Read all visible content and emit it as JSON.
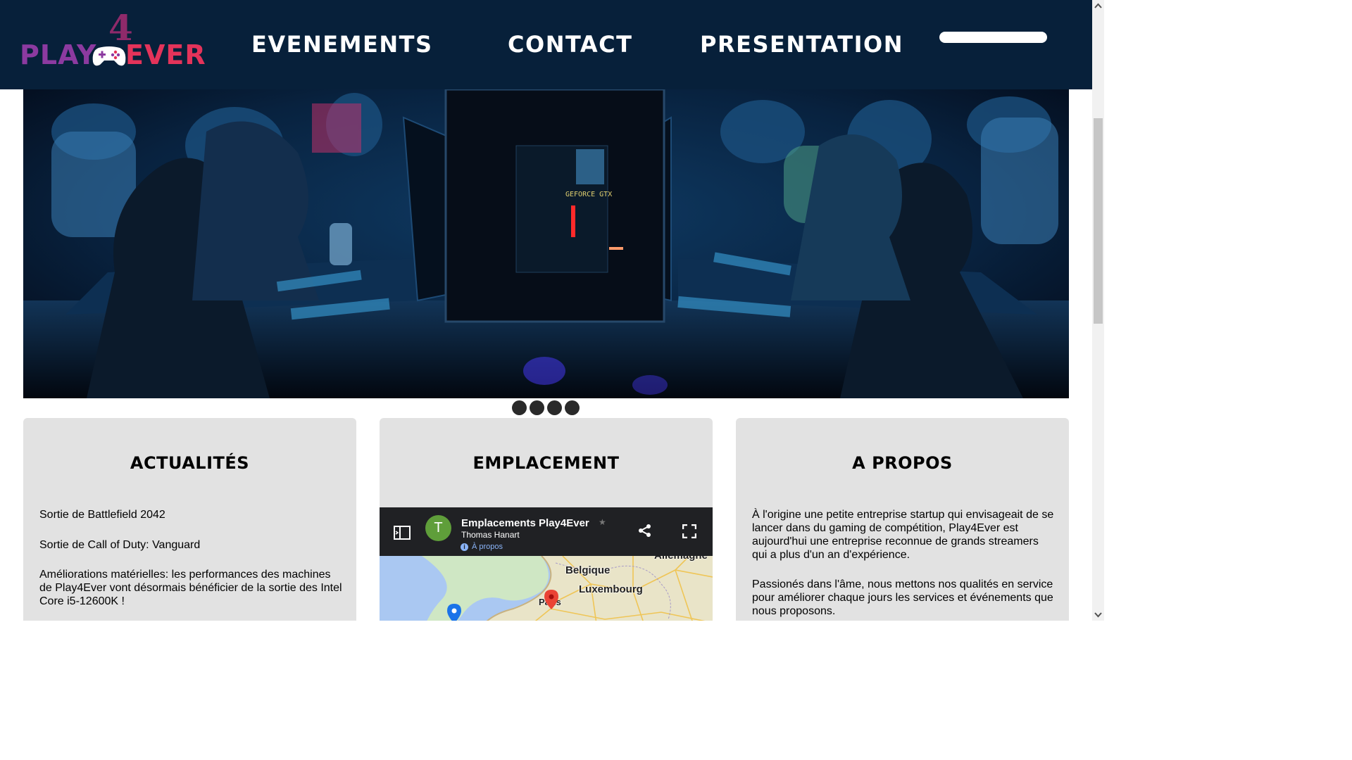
{
  "header": {
    "logo": {
      "four": "4",
      "play": "PLAY",
      "ever": "EVER",
      "alt": "Play4Ever"
    },
    "nav": [
      {
        "label": "EVENEMENTS"
      },
      {
        "label": "CONTACT"
      },
      {
        "label": "PRESENTATION"
      }
    ],
    "search": {
      "placeholder": ""
    }
  },
  "hero": {
    "image": "esports-lan-tournament-photo",
    "slides": 4
  },
  "cards": {
    "news": {
      "title": "ACTUALITÉS",
      "items": [
        "Sortie de Battlefield 2042",
        "Sortie de Call of Duty: Vanguard",
        "Améliorations matérielles: les performances des machines de Play4Ever vont désormais bénéficier de la sortie des Intel Core i5-12600K !"
      ]
    },
    "location": {
      "title": "EMPLACEMENT",
      "map": {
        "avatar_letter": "T",
        "name": "Emplacements Play4Ever",
        "owner": "Thomas Hanart",
        "about": "À propos",
        "labels": [
          "Belgique",
          "Luxembourg",
          "Allemagne",
          "Paris"
        ]
      }
    },
    "about": {
      "title": "A PROPOS",
      "paragraphs": [
        "À l'origine une petite entreprise startup qui envisageait de se lancer dans du gaming de compétition, Play4Ever est aujourd'hui une entreprise reconnue de grands streamers qui a plus d'un an d'expérience.",
        "Passionés dans l'âme, nous mettons nos qualités en service pour améliorer chaque jours les services et événements que nous proposons."
      ]
    }
  },
  "colors": {
    "header_bg": "#07203a",
    "logo_purple": "#8c3aa0",
    "logo_red": "#e4335a",
    "card_bg": "#e2e2e2"
  }
}
